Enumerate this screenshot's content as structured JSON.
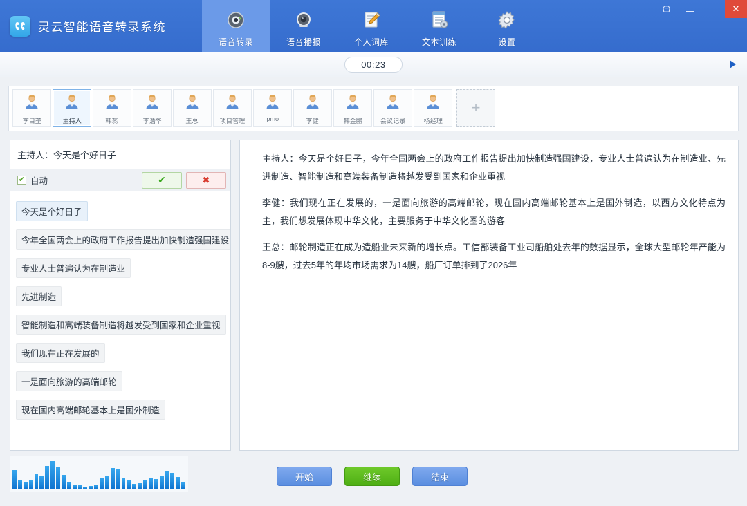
{
  "window": {
    "app_title": "灵云智能语音转录系统",
    "logo_icon": "app-logo-icon",
    "controls": {
      "pin_label": "♡",
      "minimize_label": "",
      "maximize_label": "",
      "close_label": ""
    }
  },
  "nav": {
    "tabs": [
      {
        "label": "语音转录",
        "icon": "record-disc-icon",
        "active": true
      },
      {
        "label": "语音播报",
        "icon": "speaker-icon",
        "active": false
      },
      {
        "label": "个人词库",
        "icon": "notepad-pencil-icon",
        "active": false
      },
      {
        "label": "文本训练",
        "icon": "document-gear-icon",
        "active": false
      },
      {
        "label": "设置",
        "icon": "gear-icon",
        "active": false
      }
    ]
  },
  "timer": {
    "value": "00:23",
    "play_icon": "play-triangle-icon"
  },
  "speakers": {
    "tabs": [
      {
        "name": "李目垄",
        "active": false
      },
      {
        "name": "主持人",
        "active": true
      },
      {
        "name": "韩蕊",
        "active": false
      },
      {
        "name": "李浩华",
        "active": false
      },
      {
        "name": "王总",
        "active": false
      },
      {
        "name": "项目管理",
        "active": false
      },
      {
        "name": "pmo",
        "active": false
      },
      {
        "name": "李健",
        "active": false
      },
      {
        "name": "韩金鹏",
        "active": false
      },
      {
        "name": "会议记录",
        "active": false
      },
      {
        "name": "杨经理",
        "active": false
      }
    ],
    "add_label": "+",
    "avatar_icon": "user-avatar-icon"
  },
  "left_panel": {
    "current_line": "主持人：今天是个好日子",
    "auto_label": "自动",
    "auto_checked": true,
    "confirm_icon": "check-icon",
    "reject_icon": "cross-icon",
    "chips": [
      {
        "text": "今天是个好日子",
        "selected": true
      },
      {
        "text": "今年全国两会上的政府工作报告提出加快制造强国建设",
        "selected": false
      },
      {
        "text": "专业人士普遍认为在制造业",
        "selected": false
      },
      {
        "text": "先进制造",
        "selected": false
      },
      {
        "text": "智能制造和高端装备制造将越发受到国家和企业重视",
        "selected": false
      },
      {
        "text": "我们现在正在发展的",
        "selected": false
      },
      {
        "text": "一是面向旅游的高端邮轮",
        "selected": false
      },
      {
        "text": "现在国内高端邮轮基本上是国外制造",
        "selected": false
      }
    ]
  },
  "transcript": {
    "paragraphs": [
      "主持人：今天是个好日子，今年全国两会上的政府工作报告提出加快制造强国建设，专业人士普遍认为在制造业、先进制造、智能制造和高端装备制造将越发受到国家和企业重视",
      "李健：我们现在正在发展的，一是面向旅游的高端邮轮，现在国内高端邮轮基本上是国外制造，以西方文化特点为主，我们想发展体现中华文化，主要服务于中华文化圈的游客",
      "王总：邮轮制造正在成为造船业未来新的增长点。工信部装备工业司船舶处去年的数据显示，全球大型邮轮年产能为8-9艘，过去5年的年均市场需求为14艘，船厂订单排到了2026年"
    ]
  },
  "waveform": {
    "bars": [
      28,
      14,
      11,
      13,
      22,
      20,
      34,
      41,
      33,
      21,
      11,
      7,
      6,
      4,
      5,
      7,
      17,
      19,
      31,
      29,
      16,
      13,
      8,
      9,
      14,
      17,
      15,
      19,
      27,
      24,
      18,
      10
    ],
    "color": "#1f8fe0"
  },
  "actions": {
    "start_label": "开始",
    "continue_label": "继续",
    "end_label": "结束"
  },
  "colors": {
    "accent_blue": "#3a72d2",
    "active_tab": "#6b9ae8",
    "green": "#5aa832",
    "close_red": "#e04a3a"
  }
}
